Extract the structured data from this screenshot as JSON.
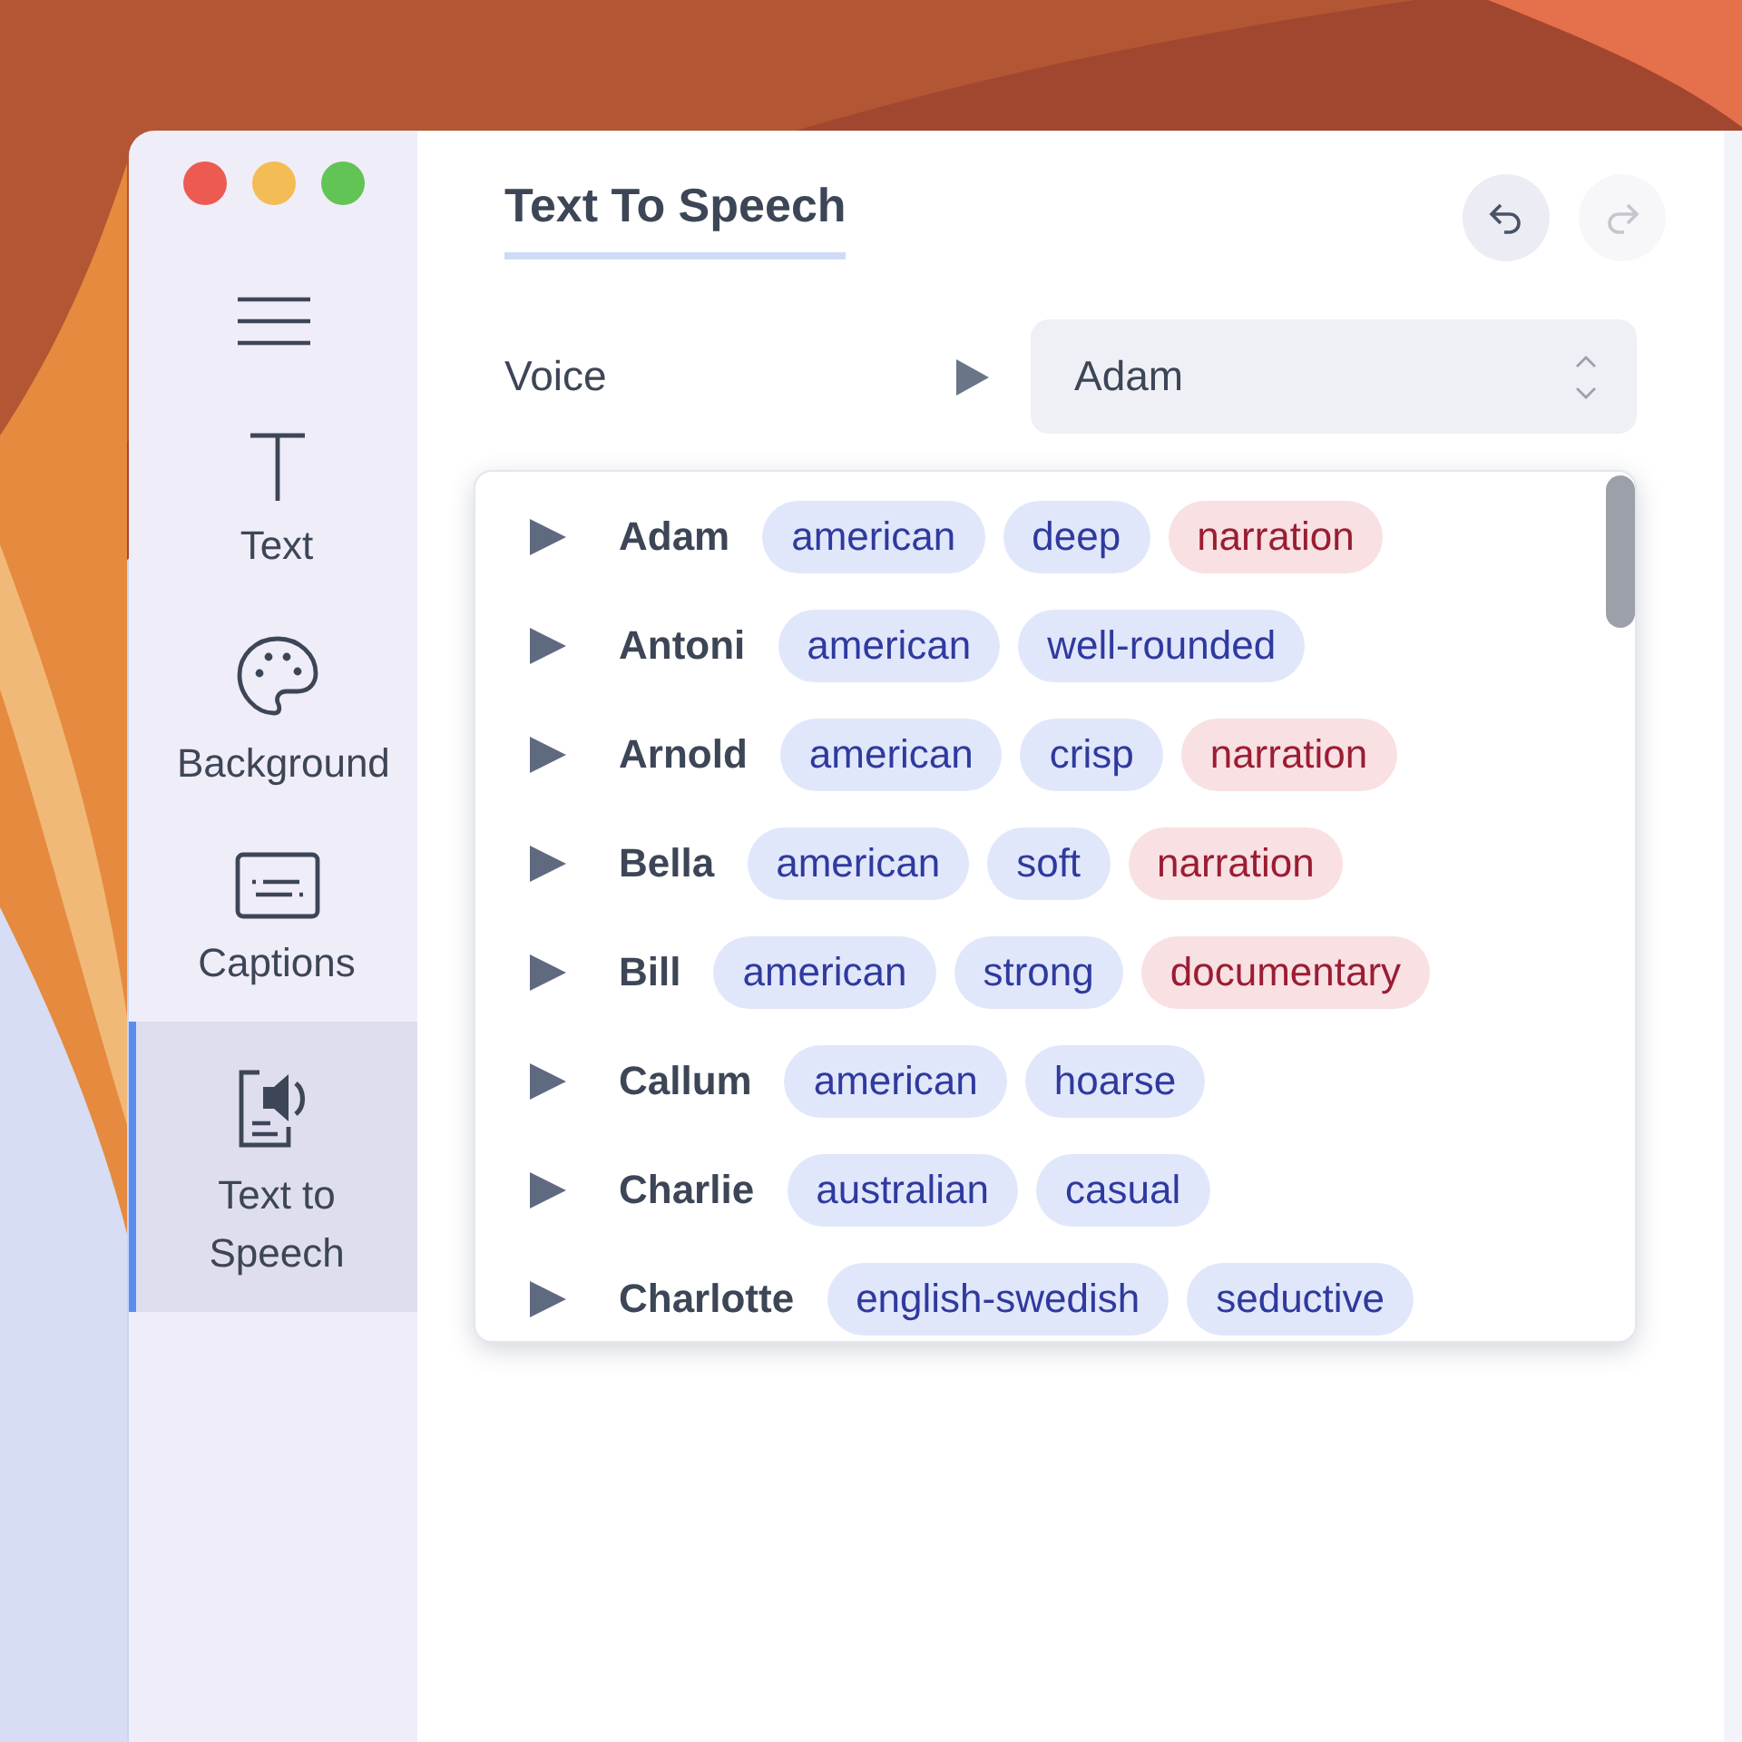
{
  "sidebar": {
    "items": [
      {
        "label": "Text",
        "selected": false
      },
      {
        "label": "Background",
        "selected": false
      },
      {
        "label": "Captions",
        "selected": false
      },
      {
        "label": "Text to Speech",
        "selected": true
      }
    ]
  },
  "header": {
    "title": "Text To Speech",
    "undo": {
      "disabled": false
    },
    "redo": {
      "disabled": true
    }
  },
  "voice": {
    "label": "Voice",
    "value": "Adam"
  },
  "voice_list": [
    {
      "name": "Adam",
      "tags": [
        {
          "text": "american",
          "kind": "trait"
        },
        {
          "text": "deep",
          "kind": "trait"
        },
        {
          "text": "narration",
          "kind": "use"
        }
      ]
    },
    {
      "name": "Antoni",
      "tags": [
        {
          "text": "american",
          "kind": "trait"
        },
        {
          "text": "well-rounded",
          "kind": "trait"
        }
      ]
    },
    {
      "name": "Arnold",
      "tags": [
        {
          "text": "american",
          "kind": "trait"
        },
        {
          "text": "crisp",
          "kind": "trait"
        },
        {
          "text": "narration",
          "kind": "use"
        }
      ]
    },
    {
      "name": "Bella",
      "tags": [
        {
          "text": "american",
          "kind": "trait"
        },
        {
          "text": "soft",
          "kind": "trait"
        },
        {
          "text": "narration",
          "kind": "use"
        }
      ]
    },
    {
      "name": "Bill",
      "tags": [
        {
          "text": "american",
          "kind": "trait"
        },
        {
          "text": "strong",
          "kind": "trait"
        },
        {
          "text": "documentary",
          "kind": "use"
        }
      ]
    },
    {
      "name": "Callum",
      "tags": [
        {
          "text": "american",
          "kind": "trait"
        },
        {
          "text": "hoarse",
          "kind": "trait"
        }
      ]
    },
    {
      "name": "Charlie",
      "tags": [
        {
          "text": "australian",
          "kind": "trait"
        },
        {
          "text": "casual",
          "kind": "trait"
        }
      ]
    },
    {
      "name": "Charlotte",
      "tags": [
        {
          "text": "english-swedish",
          "kind": "trait"
        },
        {
          "text": "seductive",
          "kind": "trait"
        }
      ]
    }
  ]
}
